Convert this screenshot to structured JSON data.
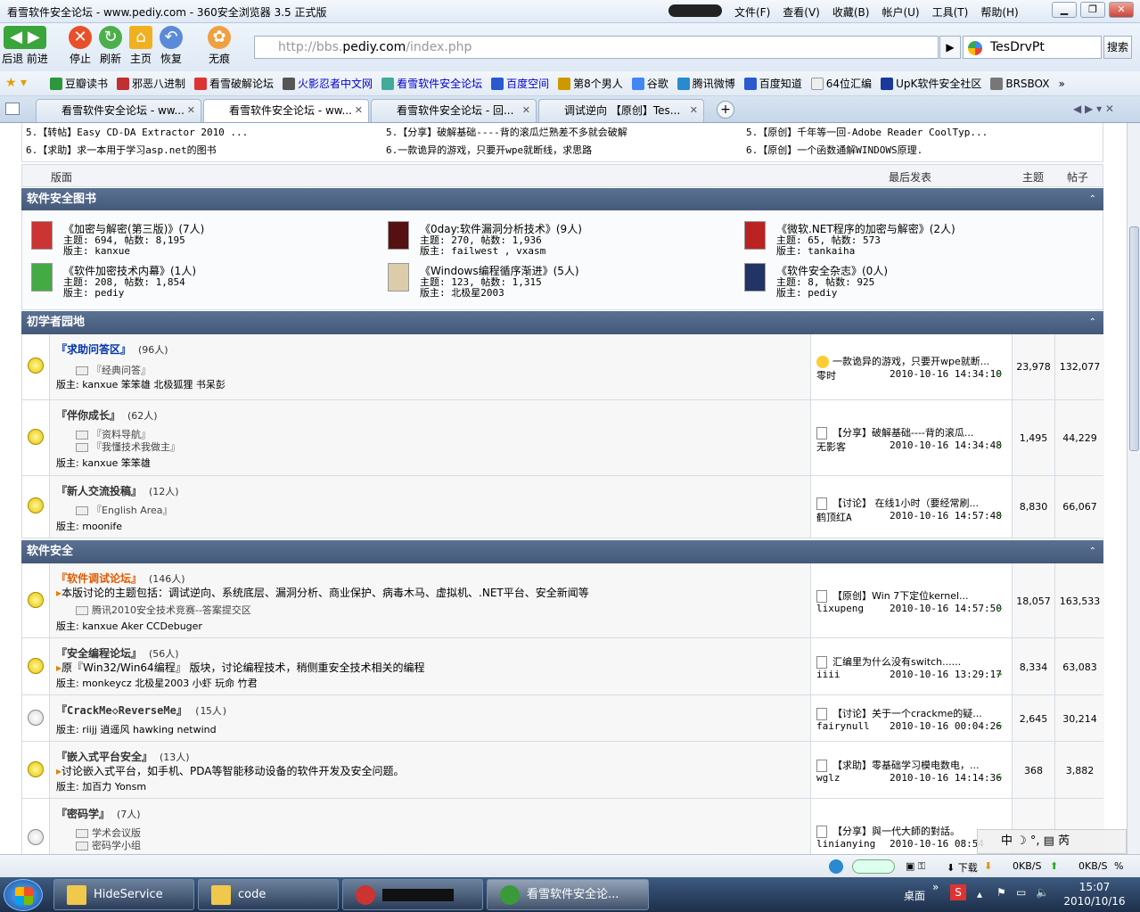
{
  "window": {
    "title": "看雪软件安全论坛 - www.pediy.com - 360安全浏览器 3.5 正式版",
    "menu": [
      "文件(F)",
      "查看(V)",
      "收藏(B)",
      "帐户(U)",
      "工具(T)",
      "帮助(H)"
    ]
  },
  "nav": {
    "back_fwd": "后退 前进",
    "stop": "停止",
    "refresh": "刷新",
    "home": "主页",
    "restore": "恢复",
    "notrace": "无痕",
    "address_prefix": "http://bbs.",
    "address_domain": "pediy.com",
    "address_suffix": "/index.php",
    "search_value": "TesDrvPt",
    "search_button": "搜索"
  },
  "favorites": [
    "豆瓣读书",
    "邪恶八进制",
    "看雪破解论坛",
    "火影忍者中文网",
    "看雪软件安全论坛",
    "百度空间",
    "第8个男人",
    "谷歌",
    "腾讯微博",
    "百度知道",
    "64位汇编",
    "UpK软件安全社区",
    "BRSBOX"
  ],
  "tabs": [
    "看雪软件安全论坛 - ww...",
    "看雪软件安全论坛 - ww...",
    "看雪软件安全论坛 - 回...",
    "调试逆向 【原创】Tes..."
  ],
  "hot": [
    [
      "5.【转帖】Easy CD-DA Extractor 2010 ...",
      "5.【分享】破解基础----背的滚瓜烂熟差不多就会破解",
      "5.【原创】千年等一回-Adobe Reader CoolTyp..."
    ],
    [
      "6.【求助】求一本用于学习asp.net的图书",
      "6.一款诡异的游戏，只要开wpe就断线，求思路",
      "6.【原创】一个函数通解WINDOWS原理."
    ]
  ],
  "colhead": {
    "board": "版面",
    "last": "最后发表",
    "topics": "主题",
    "posts": "帖子"
  },
  "sections": {
    "books": "软件安全图书",
    "beginner": "初学者园地",
    "security": "软件安全"
  },
  "books": [
    {
      "title": "《加密与解密(第三版)》(7人)",
      "stats": "主题: 694, 帖数: 8,195",
      "mod": "版主:  kanxue"
    },
    {
      "title": "《0day:软件漏洞分析技术》(9人)",
      "stats": "主题: 270, 帖数: 1,936",
      "mod": "版主:  failwest , vxasm"
    },
    {
      "title": "《微软.NET程序的加密与解密》(2人)",
      "stats": "主题: 65, 帖数: 573",
      "mod": "版主:  tankaiha"
    },
    {
      "title": "《软件加密技术内幕》(1人)",
      "stats": "主题: 208, 帖数: 1,854",
      "mod": "版主:  pediy"
    },
    {
      "title": "《Windows编程循序渐进》(5人)",
      "stats": "主题: 123, 帖数: 1,315",
      "mod": "版主:  北极星2003"
    },
    {
      "title": "《软件安全杂志》(0人)",
      "stats": "主题: 8, 帖数: 925",
      "mod": "版主:  pediy"
    }
  ],
  "beginner_forums": [
    {
      "name": "『求助问答区』",
      "count": "(96人)",
      "subs": [
        "『经典问答』"
      ],
      "mods": "版主:  kanxue 笨笨雄 北极狐狸 书呆彭",
      "last_title": "一款诡异的游戏，只要开wpe就断...",
      "last_user": "零时",
      "last_time": "2010-10-16 14:34:10",
      "topics": "23,978",
      "posts": "132,077"
    },
    {
      "name": "『伴你成长』",
      "count": "(62人)",
      "subs": [
        "『资料导航』",
        "『我懂技术我做主』"
      ],
      "mods": "版主:  kanxue 笨笨雄",
      "last_title": "【分享】破解基础----背的滚瓜...",
      "last_user": "无影客",
      "last_time": "2010-10-16 14:34:48",
      "topics": "1,495",
      "posts": "44,229"
    },
    {
      "name": "『新人交流投稿』",
      "count": "(12人)",
      "subs": [
        "『English Area』"
      ],
      "mods": "版主:  moonife",
      "last_title": "【讨论】 在线1小时（要经常刷...",
      "last_user": "鹤顶红A",
      "last_time": "2010-10-16 14:57:48",
      "topics": "8,830",
      "posts": "66,067"
    }
  ],
  "security_forums": [
    {
      "name": "『软件调试论坛』",
      "count": "(146人)",
      "desc": "本版讨论的主题包括：调试逆向、系统底层、漏洞分析、商业保护、病毒木马、虚拟机、.NET平台、安全新闻等",
      "subs": [
        "腾讯2010安全技术竞赛--答案提交区"
      ],
      "mods": "版主:  kanxue Aker CCDebuger",
      "last_title": "【原创】Win 7下定位kernel...",
      "last_user": "lixupeng",
      "last_time": "2010-10-16 14:57:50",
      "topics": "18,057",
      "posts": "163,533"
    },
    {
      "name": "『安全编程论坛』",
      "count": "(56人)",
      "desc": "原『Win32/Win64编程』 版块，讨论编程技术，稍侧重安全技术相关的编程",
      "subs": [],
      "mods": "版主:  monkeycz 北极星2003 小虾 玩命 竹君",
      "last_title": "汇编里为什么没有switch......",
      "last_user": "iiii",
      "last_time": "2010-10-16 13:29:17",
      "topics": "8,334",
      "posts": "63,083"
    },
    {
      "name": "『CrackMe◇ReverseMe』",
      "count": "(15人)",
      "desc": "",
      "subs": [],
      "mods": "版主:  riijj 逍遥风 hawking netwind",
      "last_title": "【讨论】关于一个crackme的疑...",
      "last_user": "fairynull",
      "last_time": "2010-10-16 00:04:26",
      "topics": "2,645",
      "posts": "30,214"
    },
    {
      "name": "『嵌入式平台安全』",
      "count": "(13人)",
      "desc": "讨论嵌入式平台，如手机、PDA等智能移动设备的软件开发及安全问题。",
      "subs": [],
      "mods": "版主:  加百力 Yonsm",
      "last_title": "【求助】零基础学习模电数电，...",
      "last_user": "wglz",
      "last_time": "2010-10-16 14:14:36",
      "topics": "368",
      "posts": "3,882"
    },
    {
      "name": "『密码学』",
      "count": "(7人)",
      "desc": "",
      "subs": [
        "学术会议版",
        "密码学小组"
      ],
      "mods": "",
      "last_title": "【分享】與一代大師的對話。",
      "last_user": "linianying",
      "last_time": "2010-10-16 08:54",
      "topics": "",
      "posts": ""
    }
  ],
  "status": {
    "download": "下载",
    "down_speed": "0KB/S",
    "up_speed": "0KB/S"
  },
  "taskbar": {
    "items": [
      "HideService",
      "code",
      "",
      "看雪软件安全论..."
    ],
    "desktop": "桌面",
    "time": "15:07",
    "date": "2010/10/16"
  },
  "ime": "中 ☽ °, ▤ 芮"
}
